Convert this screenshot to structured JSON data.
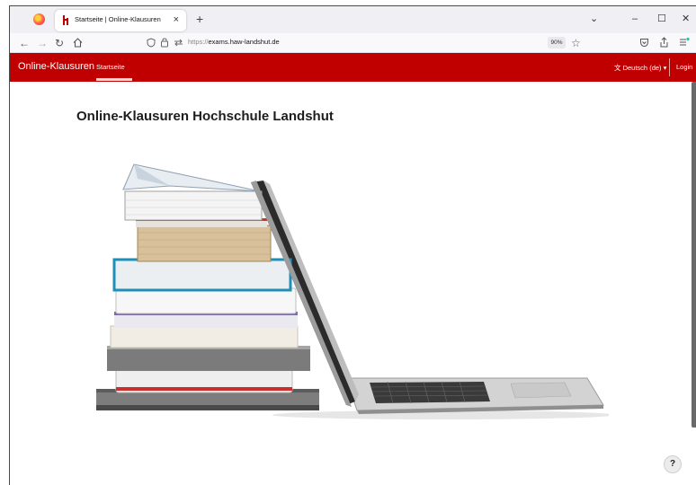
{
  "browser": {
    "tab_title": "Startseite | Online-Klausuren",
    "tab_close": "×",
    "new_tab": "+",
    "url_prefix": "https://",
    "url_host": "exams.haw-landshut.de",
    "zoom": "90%",
    "window_controls": {
      "chevron": "⌄",
      "minimize": "–",
      "maximize": "☐",
      "close": "✕"
    }
  },
  "site": {
    "brand": "Online-Klausuren",
    "nav": [
      {
        "label": "Startseite",
        "active": true
      }
    ],
    "language": "Deutsch (de)",
    "login": "Login",
    "accent_color": "#c00000"
  },
  "page": {
    "title": "Online-Klausuren Hochschule Landshut",
    "help_label": "?"
  }
}
